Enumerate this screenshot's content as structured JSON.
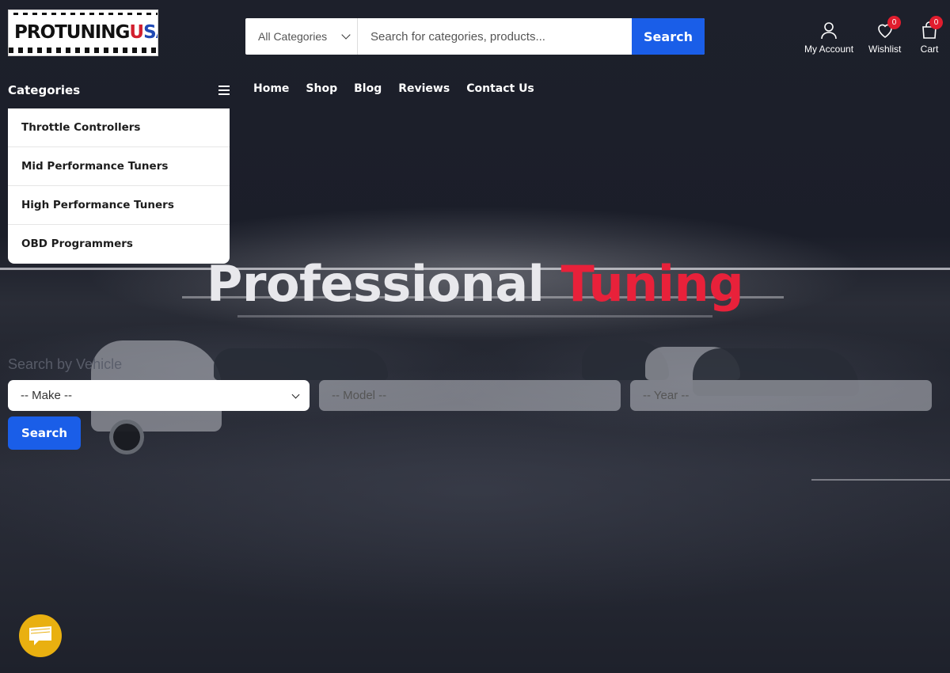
{
  "header": {
    "logo": {
      "part1": "PROTUNING",
      "part2": "U",
      "part3": "S",
      "part4": "A"
    },
    "search": {
      "category_selected": "All Categories",
      "placeholder": "Search for categories, products...",
      "button_label": "Search"
    },
    "account_label": "My Account",
    "wishlist": {
      "label": "Wishlist",
      "count": "0"
    },
    "cart": {
      "label": "Cart",
      "count": "0"
    }
  },
  "categories": {
    "title": "Categories",
    "items": [
      "Throttle Controllers",
      "Mid Performance Tuners",
      "High Performance Tuners",
      "OBD Programmers"
    ]
  },
  "nav": {
    "items": [
      "Home",
      "Shop",
      "Blog",
      "Reviews",
      "Contact Us"
    ]
  },
  "hero": {
    "title_main": "Professional",
    "title_accent": "Tuning"
  },
  "vehicle_search": {
    "title": "Search by Vehicle",
    "make": "-- Make --",
    "model": "-- Model --",
    "year": "-- Year --",
    "button_label": "Search"
  },
  "colors": {
    "accent_blue": "#1a5ee8",
    "accent_red": "#e8213a",
    "chat_yellow": "#e9b010"
  },
  "icons": [
    "user-icon",
    "heart-icon",
    "bag-icon",
    "hamburger-icon",
    "chevron-down-icon",
    "chat-icon"
  ]
}
